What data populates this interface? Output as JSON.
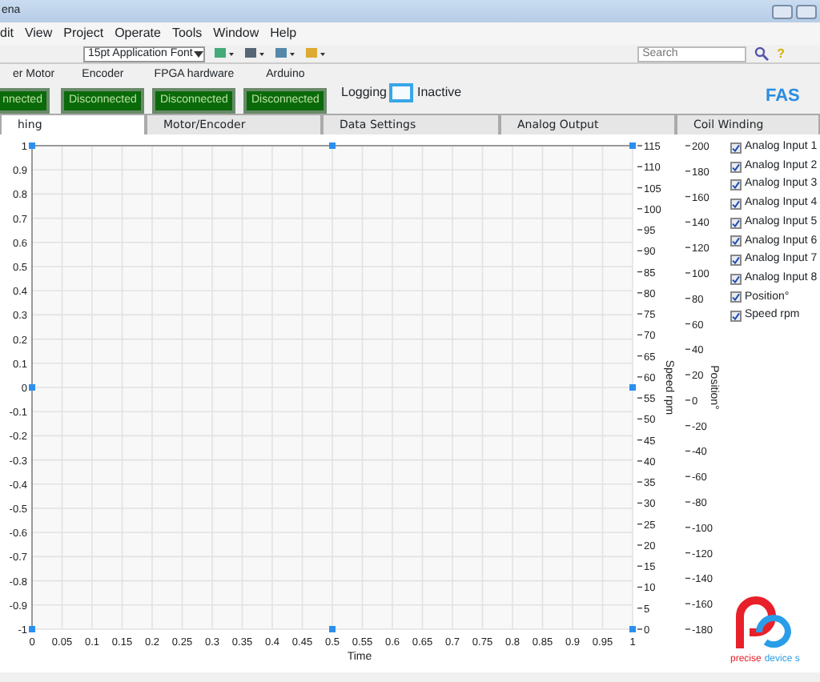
{
  "window": {
    "title": "ena"
  },
  "menu": [
    "dit",
    "View",
    "Project",
    "Operate",
    "Tools",
    "Window",
    "Help"
  ],
  "toolbar": {
    "font": "15pt Application Font",
    "search": {
      "placeholder": "Search"
    },
    "help": "?"
  },
  "indicators": [
    {
      "label": "er Motor",
      "value": "nnected"
    },
    {
      "label": "Encoder",
      "value": "Disconnected"
    },
    {
      "label": "FPGA hardware",
      "value": "Disconnected"
    },
    {
      "label": "Arduino",
      "value": "Disconnected"
    }
  ],
  "logging": {
    "label": "Logging",
    "on": false,
    "status": "Inactive"
  },
  "logo": {
    "text": "FAS"
  },
  "tabs": [
    {
      "label": "hing",
      "selected": true
    },
    {
      "label": "Motor/Encoder",
      "selected": false
    },
    {
      "label": "Data Settings",
      "selected": false
    },
    {
      "label": "Analog Output",
      "selected": false
    },
    {
      "label": "Coil Winding",
      "selected": false
    }
  ],
  "graph": {
    "chart_data": {
      "type": "scatter",
      "grid": true,
      "xlabel": "Time",
      "x": [
        0,
        0.5,
        1,
        0,
        1,
        0,
        0.5,
        1
      ],
      "series": [
        {
          "color": "#2b8ff0",
          "values": [
            1,
            1,
            1,
            0,
            0,
            -1,
            -1,
            -1
          ]
        }
      ],
      "xlim": [
        0,
        1
      ],
      "ylim": [
        -1,
        1
      ],
      "xticks": [
        0,
        0.05,
        0.1,
        0.15,
        0.2,
        0.25,
        0.3,
        0.35,
        0.4,
        0.45,
        0.5,
        0.55,
        0.6,
        0.65,
        0.7,
        0.75,
        0.8,
        0.85,
        0.9,
        0.95,
        1
      ],
      "yticks": [
        1,
        0.9,
        0.8,
        0.7,
        0.6,
        0.5,
        0.4,
        0.3,
        0.2,
        0.1,
        0,
        -0.1,
        -0.2,
        -0.3,
        -0.4,
        -0.5,
        -0.6,
        -0.7,
        -0.8,
        -0.9,
        -1
      ]
    },
    "right_axes": [
      {
        "label": "Speed rpm",
        "ticks": [
          "115",
          "110",
          "105",
          "100",
          "95",
          "90",
          "85",
          "80",
          "75",
          "70",
          "65",
          "60",
          "55",
          "50",
          "45",
          "40",
          "35",
          "30",
          "25",
          "20",
          "15",
          "10",
          "5",
          "0"
        ]
      },
      {
        "label": "Position°",
        "ticks": [
          "200",
          "180",
          "160",
          "140",
          "120",
          "100",
          "80",
          "60",
          "40",
          "20",
          "0",
          "-20",
          "-40",
          "-60",
          "-80",
          "-100",
          "-120",
          "-140",
          "-160",
          "-180"
        ]
      }
    ]
  },
  "legend": [
    {
      "label": "Analog Input 1",
      "checked": true
    },
    {
      "label": "Analog Input 2",
      "checked": true
    },
    {
      "label": "Analog Input 3",
      "checked": true
    },
    {
      "label": "Analog Input 4",
      "checked": true
    },
    {
      "label": "Analog Input 5",
      "checked": true
    },
    {
      "label": "Analog Input 6",
      "checked": true
    },
    {
      "label": "Analog Input 7",
      "checked": true
    },
    {
      "label": "Analog Input 8",
      "checked": true
    },
    {
      "label": "Position°",
      "checked": true
    },
    {
      "label": "Speed rpm",
      "checked": true
    }
  ],
  "brand": [
    {
      "text": "precise",
      "color": "#e8202a"
    },
    {
      "text": "device s",
      "color": "#2a9de8"
    }
  ]
}
